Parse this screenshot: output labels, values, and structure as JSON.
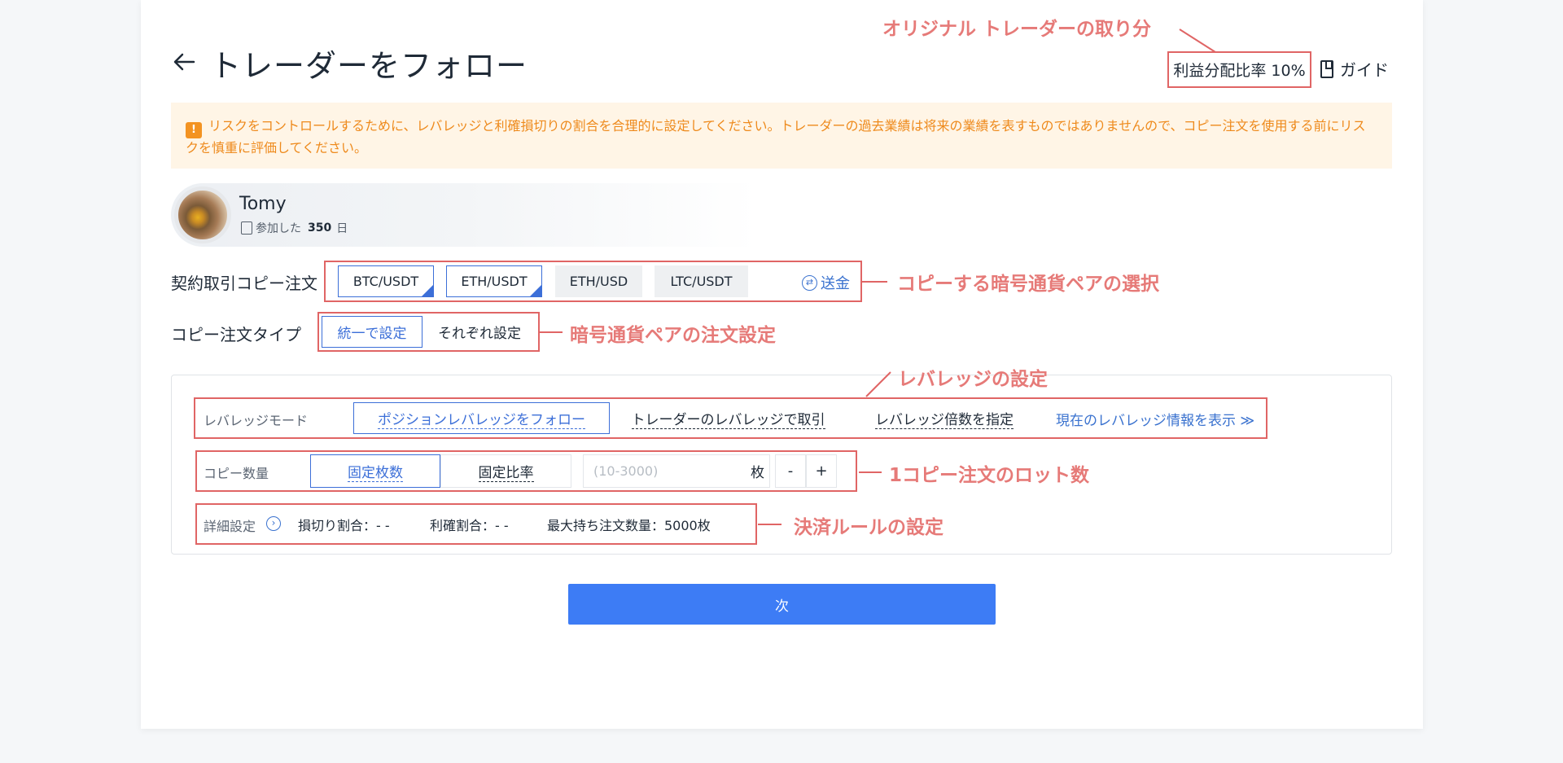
{
  "header": {
    "title": "トレーダーをフォロー",
    "profit_share": "利益分配比率 10%",
    "guide": "ガイド"
  },
  "warning": {
    "text": "リスクをコントロールするために、レバレッジと利確損切りの割合を合理的に設定してください。トレーダーの過去業績は将来の業績を表すものではありませんので、コピー注文を使用する前にリスクを慎重に評価してください。"
  },
  "trader": {
    "name": "Tomy",
    "joined_label": "参加した",
    "joined_days": "350",
    "joined_unit": "日"
  },
  "pairs": {
    "label": "契約取引コピー注文",
    "items": [
      {
        "label": "BTC/USDT",
        "selected": true
      },
      {
        "label": "ETH/USDT",
        "selected": true
      },
      {
        "label": "ETH/USD",
        "selected": false
      },
      {
        "label": "LTC/USDT",
        "selected": false
      }
    ],
    "transfer": "送金"
  },
  "order_type": {
    "label": "コピー注文タイプ",
    "options": [
      "統一で設定",
      "それぞれ設定"
    ],
    "selected": "統一で設定"
  },
  "leverage": {
    "label": "レバレッジモード",
    "options": [
      "ポジションレバレッジをフォロー",
      "トレーダーのレバレッジで取引",
      "レバレッジ倍数を指定"
    ],
    "selected": "ポジションレバレッジをフォロー",
    "info_link": "現在のレバレッジ情報を表示 ≫"
  },
  "quantity": {
    "label": "コピー数量",
    "options": [
      "固定枚数",
      "固定比率"
    ],
    "selected": "固定枚数",
    "placeholder": "(10-3000)",
    "unit": "枚",
    "minus": "-",
    "plus": "+"
  },
  "details": {
    "label": "詳細設定",
    "stop_loss": "損切り割合：- -",
    "take_profit": "利確割合：- -",
    "max_orders": "最大持ち注文数量：5000枚"
  },
  "next_button": "次",
  "annotations": {
    "trader_share": "オリジナル トレーダーの取り分",
    "pair_selection": "コピーする暗号通貨ペアの選択",
    "order_setting": "暗号通貨ペアの注文設定",
    "leverage_setting": "レバレッジの設定",
    "lot_count": "1コピー注文のロット数",
    "exit_rules": "決済ルールの設定"
  },
  "colors": {
    "accent": "#3c6fd8",
    "annotation": "#e06565",
    "warning_bg": "#fff5e6",
    "warning_text": "#ee8a1c",
    "primary_button": "#3d7cf5"
  }
}
